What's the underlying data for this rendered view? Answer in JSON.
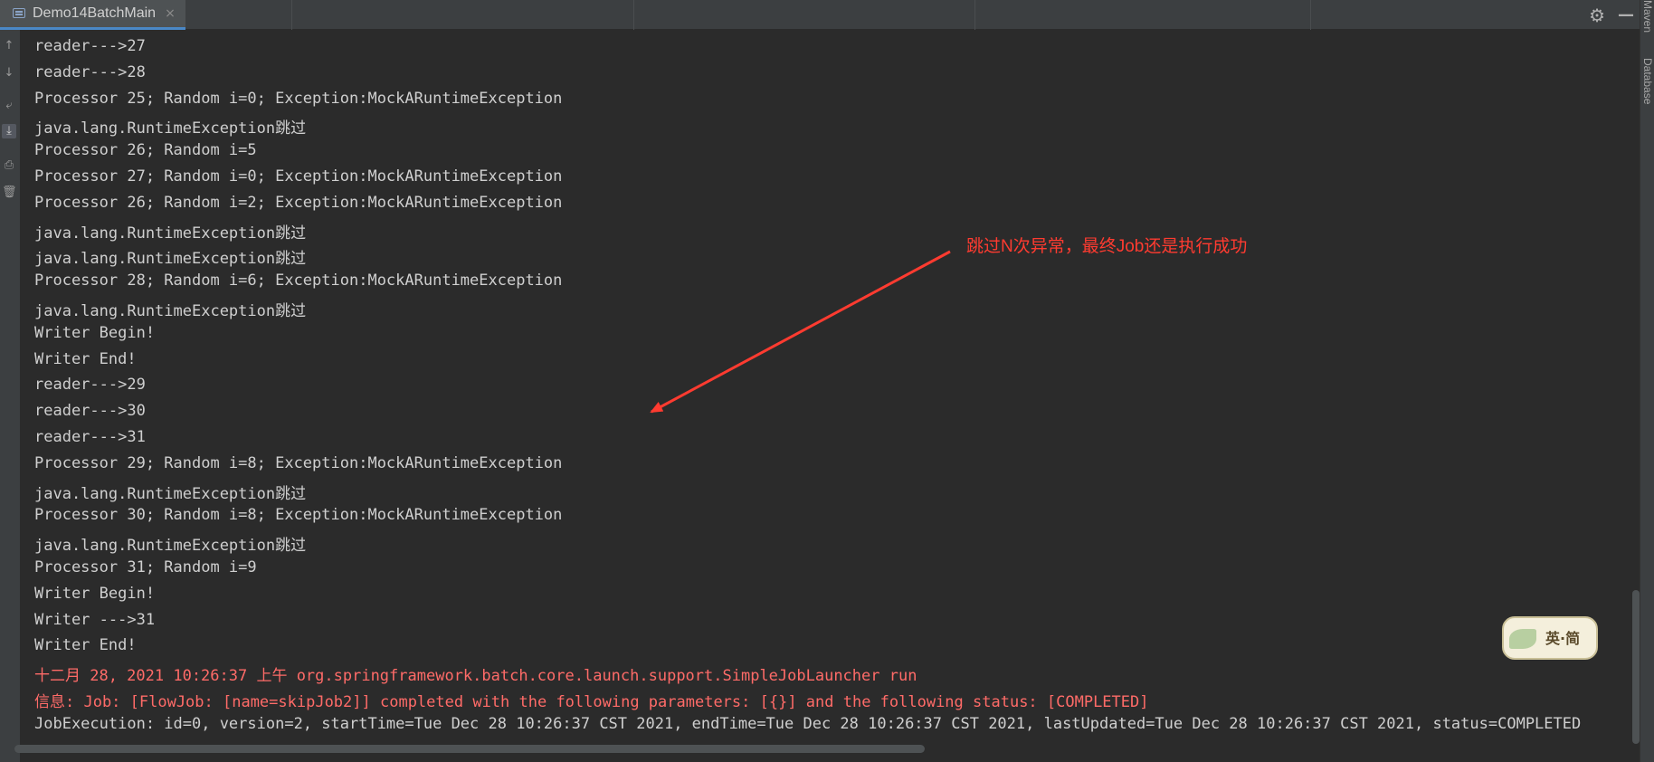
{
  "tab": {
    "label": "Demo14BatchMain",
    "close": "×"
  },
  "toolbar": {
    "gear": "⚙",
    "minimize": "—"
  },
  "right_strip": {
    "maven": "Maven",
    "database": "Database"
  },
  "console": {
    "lines": [
      {
        "text": "reader--->27",
        "type": "normal"
      },
      {
        "text": "reader--->28",
        "type": "normal"
      },
      {
        "text": "Processor 25; Random i=0; Exception:MockARuntimeException",
        "type": "normal"
      },
      {
        "text": "java.lang.RuntimeException跳过",
        "type": "normal"
      },
      {
        "text": "Processor 26; Random i=5",
        "type": "normal"
      },
      {
        "text": "Processor 27; Random i=0; Exception:MockARuntimeException",
        "type": "normal"
      },
      {
        "text": "Processor 26; Random i=2; Exception:MockARuntimeException",
        "type": "normal"
      },
      {
        "text": "java.lang.RuntimeException跳过",
        "type": "normal"
      },
      {
        "text": "java.lang.RuntimeException跳过",
        "type": "normal"
      },
      {
        "text": "Processor 28; Random i=6; Exception:MockARuntimeException",
        "type": "normal"
      },
      {
        "text": "java.lang.RuntimeException跳过",
        "type": "normal"
      },
      {
        "text": "Writer Begin!",
        "type": "normal"
      },
      {
        "text": "Writer End!",
        "type": "normal"
      },
      {
        "text": "reader--->29",
        "type": "normal"
      },
      {
        "text": "reader--->30",
        "type": "normal"
      },
      {
        "text": "reader--->31",
        "type": "normal"
      },
      {
        "text": "Processor 29; Random i=8; Exception:MockARuntimeException",
        "type": "normal"
      },
      {
        "text": "java.lang.RuntimeException跳过",
        "type": "normal"
      },
      {
        "text": "Processor 30; Random i=8; Exception:MockARuntimeException",
        "type": "normal"
      },
      {
        "text": "java.lang.RuntimeException跳过",
        "type": "normal"
      },
      {
        "text": "Processor 31; Random i=9",
        "type": "normal"
      },
      {
        "text": "Writer Begin!",
        "type": "normal"
      },
      {
        "text": "Writer --->31",
        "type": "normal"
      },
      {
        "text": "Writer End!",
        "type": "normal"
      },
      {
        "text": "十二月 28, 2021 10:26:37 上午 org.springframework.batch.core.launch.support.SimpleJobLauncher run",
        "type": "err"
      },
      {
        "text": "信息: Job: [FlowJob: [name=skipJob2]] completed with the following parameters: [{}] and the following status: [COMPLETED]",
        "type": "err"
      },
      {
        "text": "JobExecution: id=0, version=2, startTime=Tue Dec 28 10:26:37 CST 2021, endTime=Tue Dec 28 10:26:37 CST 2021, lastUpdated=Tue Dec 28 10:26:37 CST 2021, status=COMPLETED",
        "type": "normal"
      }
    ]
  },
  "annotation": {
    "text": "跳过N次异常，最终Job还是执行成功",
    "color": "#ff3b30"
  },
  "watermark": {
    "text": "英·简"
  },
  "colors": {
    "background": "#2b2b2b",
    "text": "#cfcfcf",
    "error_text": "#ff6b68",
    "accent": "#4a88c7"
  }
}
